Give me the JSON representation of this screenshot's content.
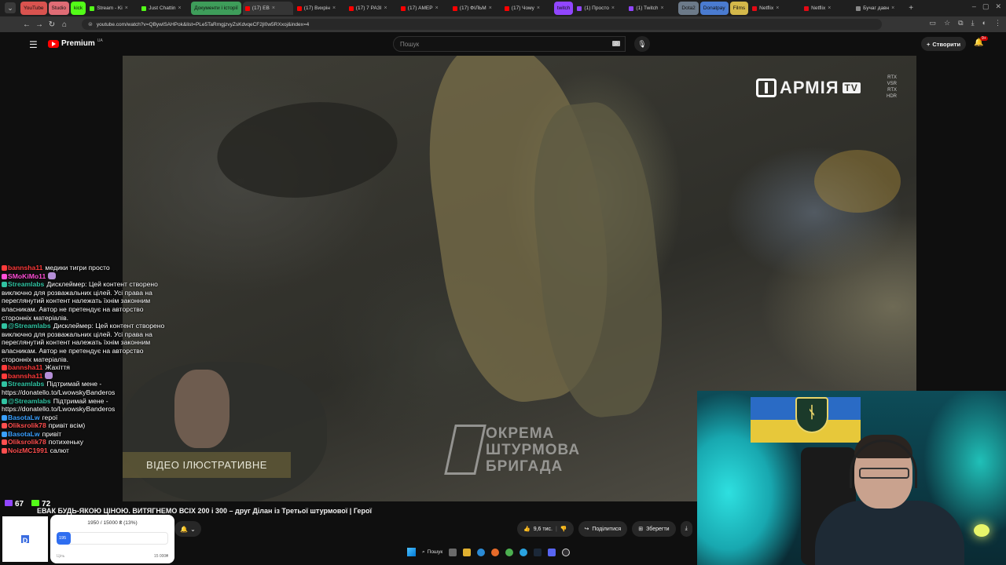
{
  "browser": {
    "tabs": [
      {
        "label": "YouTube",
        "chip": true,
        "color": "#d9534f"
      },
      {
        "label": "Studio",
        "chip": true,
        "color": "#e06c75"
      },
      {
        "label": "kick",
        "chip": true,
        "color": "#53fc18"
      },
      {
        "label": "Stream - Ki",
        "color": "#53fc18"
      },
      {
        "label": "Just Chattin",
        "color": "#53fc18"
      },
      {
        "label": "Документи і історії",
        "chip": true,
        "color": "#3e9d5a"
      },
      {
        "label": "(17) ЕВ",
        "active": true,
        "color": "#ff0000"
      },
      {
        "label": "(17) Вихрін",
        "color": "#ff0000"
      },
      {
        "label": "(17) 7 РАЗІ",
        "color": "#ff0000"
      },
      {
        "label": "(17) АМЕР",
        "color": "#ff0000"
      },
      {
        "label": "(17) ФІЛЬМ",
        "color": "#ff0000"
      },
      {
        "label": "(17) Чому",
        "color": "#ff0000"
      },
      {
        "label": "twitch",
        "chip": true,
        "color": "#9146ff"
      },
      {
        "label": "(1) Просто",
        "color": "#9146ff"
      },
      {
        "label": "(1) Twitch",
        "color": "#9146ff"
      },
      {
        "label": "Dota2",
        "chip": true,
        "color": "#6c7a89"
      },
      {
        "label": "Donatpay",
        "chip": true,
        "color": "#4a7bd0"
      },
      {
        "label": "Films",
        "chip": true,
        "color": "#d4b84a"
      },
      {
        "label": "Netflix",
        "color": "#e50914"
      },
      {
        "label": "Netflix",
        "color": "#e50914"
      },
      {
        "label": "Бучаг давн",
        "color": "#888888"
      }
    ],
    "url": "youtube.com/watch?v=QBywlSAHPok&list=PLe5TaRmgjzvyZsKdvqeCF2jl0w5RXxoj&index=4"
  },
  "youtube": {
    "brand": "Premium",
    "country": "UA",
    "search_placeholder": "Пошук",
    "create_label": "Створити",
    "notif_count": "9+"
  },
  "video": {
    "channel_watermark": "АРМІЯ",
    "channel_watermark_tv": "TV",
    "quality_badges": [
      "RTX",
      "VSR",
      "RTX",
      "HDR"
    ],
    "brigade_lines": [
      "ОКРЕМА",
      "ШТУРМОВА",
      "БРИГАДА"
    ],
    "illustrative_label": "ВІДЕО ІЛЮСТРАТИВНЕ",
    "title": "ЕВАК БУДЬ-ЯКОЮ ЦІНОЮ. ВИТЯГНЕМО ВСІХ 200 і 300 – друг Ділан із Третьої штурмової | Герої",
    "likes": "9,6 тис.",
    "share_label": "Поділитися",
    "save_label": "Зберегти"
  },
  "chat": {
    "messages": [
      {
        "user": "bannsha11",
        "color": "#ff3b3b",
        "text": "медики тигри просто"
      },
      {
        "user": "SMoKiMo11",
        "color": "#ff4fd8",
        "text": ""
      },
      {
        "user": "Streamlabs",
        "color": "#31c3a2",
        "text": "Дисклеймер: Цей контент створено виключно для розважальних цілей. Усі права на переглянутий контент належать їхнім законним власникам. Автор не претендує на авторство сторонніх матеріалів."
      },
      {
        "user": "@Streamlabs",
        "color": "#31c3a2",
        "text": "Дисклеймер: Цей контент створено виключно для розважальних цілей. Усі права на переглянутий контент належать їхнім законним власникам. Автор не претендує на авторство сторонніх матеріалів."
      },
      {
        "user": "bannsha11",
        "color": "#ff3b3b",
        "text": "Жахіття"
      },
      {
        "user": "bannsha11",
        "color": "#ff3b3b",
        "text": ""
      },
      {
        "user": "Streamlabs",
        "color": "#31c3a2",
        "text": "Підтримай мене - https://donatello.to/LwowskyBanderos"
      },
      {
        "user": "@Streamlabs",
        "color": "#31c3a2",
        "text": "Підтримай мене - https://donatello.to/LwowskyBanderos"
      },
      {
        "user": "BasotaLw",
        "color": "#3aa0ff",
        "text": "герої"
      },
      {
        "user": "Oliksrolik78",
        "color": "#ff4f4f",
        "text": "привіт всім)"
      },
      {
        "user": "BasotaLw",
        "color": "#3aa0ff",
        "text": "привіт"
      },
      {
        "user": "Oliksrolik78",
        "color": "#ff4f4f",
        "text": "потихеньку"
      },
      {
        "user": "NoizMC1991",
        "color": "#ff4f4f",
        "text": "салют"
      }
    ],
    "viewers_a": "67",
    "viewers_b": "72"
  },
  "donation_goal": {
    "amount_text": "1950 / 15000 ₴ (13%)",
    "progress": 0.13,
    "fill_text": "195",
    "left_label": "Ціль",
    "right_label": "15 000₴",
    "qr_letter": "D"
  },
  "taskbar": {
    "search_label": "Пошук"
  }
}
